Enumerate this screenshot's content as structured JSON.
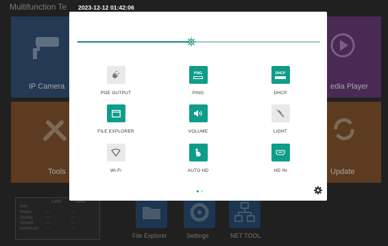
{
  "background": {
    "app_title": "Multifunction Te",
    "tiles": [
      {
        "label": "IP Camera",
        "icon": "cctv-camera-icon"
      },
      {
        "label": "edia Player",
        "icon": "play-icon"
      },
      {
        "label": "Tools",
        "icon": "tools-icon"
      },
      {
        "label": "Update",
        "icon": "refresh-icon"
      }
    ],
    "status": {
      "columns": [
        "LAN1",
        "LAN2"
      ],
      "rows": [
        {
          "key": "Port",
          "v1": "",
          "v2": ""
        },
        {
          "key": "Status",
          "v1": "---",
          "v2": "---"
        },
        {
          "key": "Quality",
          "v1": "---",
          "v2": "---"
        },
        {
          "key": "Upload",
          "v1": "---",
          "v2": "---"
        },
        {
          "key": "Download",
          "v1": "---",
          "v2": "---"
        }
      ]
    },
    "dock": [
      {
        "label": "File Explorer",
        "icon": "folder-icon"
      },
      {
        "label": "Settings",
        "icon": "gear-icon"
      },
      {
        "label": "NET TOOL",
        "icon": "network-icon"
      }
    ]
  },
  "clock": "2023-12-12 01:42:06",
  "brightness": {
    "level": 0.47,
    "icon": "brightness-icon"
  },
  "quick_settings": [
    {
      "label": "POE OUTPUT",
      "icon": "plug-icon",
      "active": false
    },
    {
      "label": "PING",
      "icon": "ping-icon",
      "icon_text": "PING",
      "active": true
    },
    {
      "label": "DHCP",
      "icon": "dhcp-icon",
      "icon_text": "DHCP",
      "active": true
    },
    {
      "label": "FILE EXPLORER",
      "icon": "folder-icon",
      "active": true
    },
    {
      "label": "VOLUME",
      "icon": "volume-icon",
      "active": true
    },
    {
      "label": "LIGHT",
      "icon": "flashlight-icon",
      "active": false
    },
    {
      "label": "Wi-Fi",
      "icon": "wifi-icon",
      "active": false
    },
    {
      "label": "AUTO HD",
      "icon": "auto-hd-icon",
      "active": true
    },
    {
      "label": "HD IN",
      "icon": "hdmi-icon",
      "active": true
    }
  ],
  "pager": {
    "pages": 2,
    "current": 1
  },
  "colors": {
    "accent": "#0f9d8a",
    "inactive": "#e9e9e9",
    "panel": "#ffffff"
  }
}
